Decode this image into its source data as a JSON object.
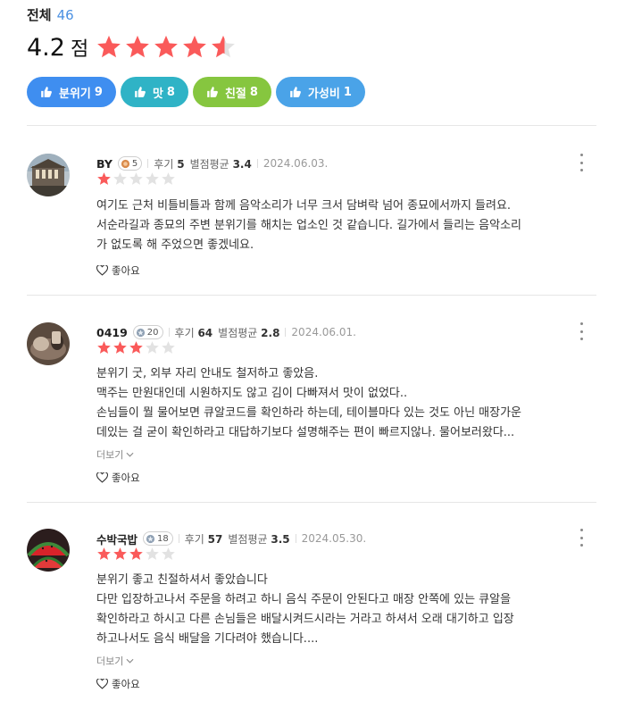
{
  "summary": {
    "total_label": "전체",
    "total_count": "46",
    "rating_value": "4.2",
    "rating_unit": "점",
    "rating_stars": 4.2
  },
  "tags": [
    {
      "label": "분위기",
      "count": "9",
      "color": "#3f8ef0",
      "icon": "thumbs-up-icon"
    },
    {
      "label": "맛",
      "count": "8",
      "color": "#2fb3c6",
      "icon": "thumbs-up-icon"
    },
    {
      "label": "친절",
      "count": "8",
      "color": "#86c63f",
      "icon": "thumbs-up-icon"
    },
    {
      "label": "가성비",
      "count": "1",
      "color": "#4aa3e8",
      "icon": "thumbs-up-icon"
    }
  ],
  "colors": {
    "star_on": "#fa5a5a",
    "star_off": "#e2e2e2"
  },
  "meta_labels": {
    "reviews": "후기",
    "avg": "별점평균",
    "expand": "더보기",
    "like": "좋아요"
  },
  "reviews": [
    {
      "nickname": "BY",
      "badge_level": "5",
      "badge_type": "bronze",
      "review_count": "5",
      "avg_rating": "3.4",
      "date": "2024.06.03.",
      "stars": 1,
      "text": "여기도 근처 비틀비틀과 함께 음악소리가 너무 크서 담벼락 넘어 종묘에서까지 들려요.\n서순라길과 종묘의 주변 분위기를 해치는 업소인 것 같습니다. 길가에서 들리는 음악소리\n가 없도록 해 주었으면 좋겠네요."
    },
    {
      "nickname": "0419",
      "badge_level": "20",
      "badge_type": "silver",
      "review_count": "64",
      "avg_rating": "2.8",
      "date": "2024.06.01.",
      "stars": 3,
      "text": "분위기 굿, 외부 자리 안내도 철저하고 좋았음.\n맥주는 만원대인데 시원하지도 않고 김이 다빠져서 맛이 없었다..\n손님들이 뭘 물어보면 큐알코드를 확인하라 하는데, 테이블마다 있는 것도 아닌 매장가운\n데있는 걸 굳이 확인하라고 대답하기보다 설명해주는 편이 빠르지않나. 물어보러왔다..."
    },
    {
      "nickname": "수박국밥",
      "badge_level": "18",
      "badge_type": "silver",
      "review_count": "57",
      "avg_rating": "3.5",
      "date": "2024.05.30.",
      "stars": 3,
      "text": "분위기 좋고 친절하셔서 좋았습니다\n다만 입장하고나서 주문을 하려고 하니 음식 주문이 안된다고 매장 안쪽에 있는 큐알을\n확인하라고 하시고 다른 손님들은 배달시켜드시라는 거라고 하셔서 오래 대기하고 입장\n하고나서도 음식 배달을 기다려야 했습니다...."
    }
  ]
}
